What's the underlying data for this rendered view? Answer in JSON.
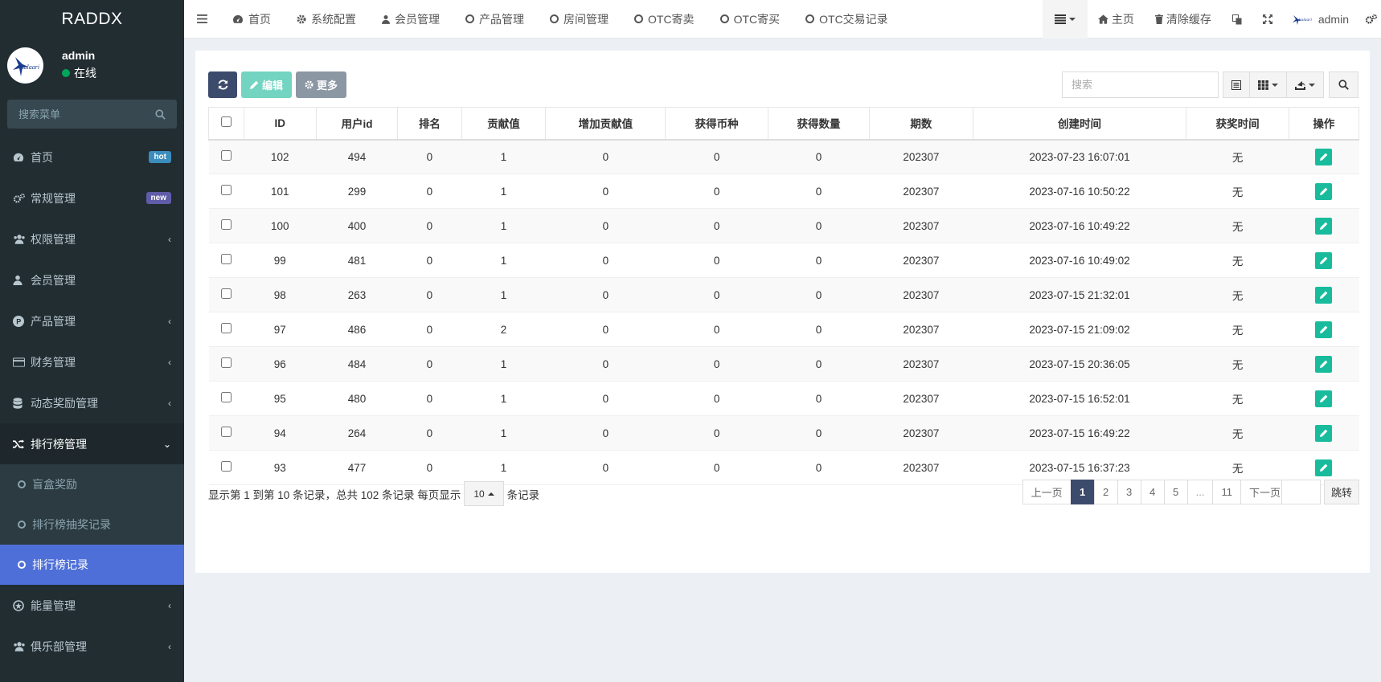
{
  "brand": "RADDX",
  "user": {
    "name": "admin",
    "status": "在线",
    "avatar_text": "kalaari"
  },
  "sidebar": {
    "search_placeholder": "搜索菜单",
    "items": [
      {
        "label": "首页",
        "badge": "hot"
      },
      {
        "label": "常规管理",
        "badge": "new"
      },
      {
        "label": "权限管理"
      },
      {
        "label": "会员管理"
      },
      {
        "label": "产品管理"
      },
      {
        "label": "财务管理"
      },
      {
        "label": "动态奖励管理"
      },
      {
        "label": "排行榜管理"
      }
    ],
    "sub_items": [
      {
        "label": "盲盒奖励"
      },
      {
        "label": "排行榜抽奖记录"
      },
      {
        "label": "排行榜记录"
      }
    ],
    "items_after": [
      {
        "label": "能量管理"
      },
      {
        "label": "俱乐部管理"
      }
    ]
  },
  "topnav": {
    "tabs": [
      "首页",
      "系统配置",
      "会员管理",
      "产品管理",
      "房间管理",
      "OTC寄卖",
      "OTC寄买",
      "OTC交易记录"
    ],
    "home": "主页",
    "clear_cache": "清除缓存",
    "user": "admin"
  },
  "toolbar": {
    "edit": "编辑",
    "more": "更多",
    "search_placeholder": "搜索"
  },
  "table": {
    "headers": [
      "ID",
      "用户id",
      "排名",
      "贡献值",
      "增加贡献值",
      "获得币种",
      "获得数量",
      "期数",
      "创建时间",
      "获奖时间",
      "操作"
    ],
    "rows": [
      [
        "102",
        "494",
        "0",
        "1",
        "0",
        "0",
        "0",
        "202307",
        "2023-07-23 16:07:01",
        "无"
      ],
      [
        "101",
        "299",
        "0",
        "1",
        "0",
        "0",
        "0",
        "202307",
        "2023-07-16 10:50:22",
        "无"
      ],
      [
        "100",
        "400",
        "0",
        "1",
        "0",
        "0",
        "0",
        "202307",
        "2023-07-16 10:49:22",
        "无"
      ],
      [
        "99",
        "481",
        "0",
        "1",
        "0",
        "0",
        "0",
        "202307",
        "2023-07-16 10:49:02",
        "无"
      ],
      [
        "98",
        "263",
        "0",
        "1",
        "0",
        "0",
        "0",
        "202307",
        "2023-07-15 21:32:01",
        "无"
      ],
      [
        "97",
        "486",
        "0",
        "2",
        "0",
        "0",
        "0",
        "202307",
        "2023-07-15 21:09:02",
        "无"
      ],
      [
        "96",
        "484",
        "0",
        "1",
        "0",
        "0",
        "0",
        "202307",
        "2023-07-15 20:36:05",
        "无"
      ],
      [
        "95",
        "480",
        "0",
        "1",
        "0",
        "0",
        "0",
        "202307",
        "2023-07-15 16:52:01",
        "无"
      ],
      [
        "94",
        "264",
        "0",
        "1",
        "0",
        "0",
        "0",
        "202307",
        "2023-07-15 16:49:22",
        "无"
      ],
      [
        "93",
        "477",
        "0",
        "1",
        "0",
        "0",
        "0",
        "202307",
        "2023-07-15 16:37:23",
        "无"
      ]
    ]
  },
  "pager": {
    "info_prefix": "显示第 1 到第 10 条记录，总共 102 条记录 每页显示",
    "page_size": "10",
    "info_suffix": "条记录",
    "prev": "上一页",
    "pages": [
      "1",
      "2",
      "3",
      "4",
      "5",
      "...",
      "11"
    ],
    "next": "下一页",
    "jump": "跳转"
  },
  "colors": {
    "sidebar_bg": "#222d32",
    "active_menu": "#4e6fd8",
    "accent": "#18bc9c",
    "primary_dark": "#3c4a6b"
  }
}
